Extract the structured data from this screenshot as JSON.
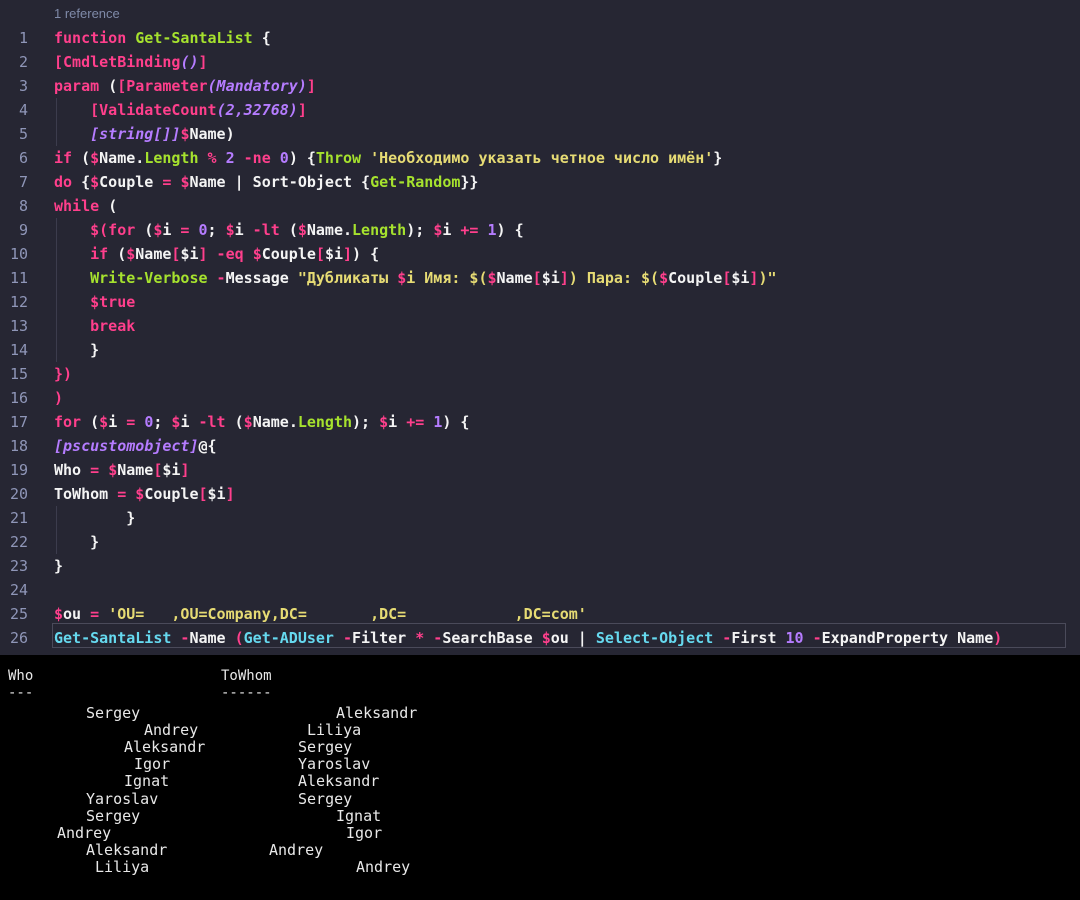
{
  "editor": {
    "codelens": "1 reference",
    "line_numbers": [
      "1",
      "2",
      "3",
      "4",
      "5",
      "6",
      "7",
      "8",
      "9",
      "10",
      "11",
      "12",
      "13",
      "14",
      "15",
      "16",
      "17",
      "18",
      "19",
      "20",
      "21",
      "22",
      "23",
      "24",
      "25",
      "26"
    ],
    "lines": [
      [
        [
          "k",
          "function "
        ],
        [
          "f",
          "Get-SantaList"
        ],
        [
          "p",
          " {"
        ]
      ],
      [
        [
          "k",
          "[CmdletBinding"
        ],
        [
          "t",
          "()"
        ],
        [
          "k",
          "]"
        ]
      ],
      [
        [
          "k",
          "param "
        ],
        [
          "p",
          "("
        ],
        [
          "k",
          "[Parameter"
        ],
        [
          "t",
          "(Mandatory)"
        ],
        [
          "k",
          "]"
        ]
      ],
      [
        [
          "p",
          "    "
        ],
        [
          "k",
          "[ValidateCount"
        ],
        [
          "t",
          "(2,32768)"
        ],
        [
          "k",
          "]"
        ]
      ],
      [
        [
          "p",
          "    "
        ],
        [
          "t",
          "[string[]]"
        ],
        [
          "k",
          "$"
        ],
        [
          "v",
          "Name)"
        ]
      ],
      [
        [
          "k",
          "if "
        ],
        [
          "p",
          "("
        ],
        [
          "k",
          "$"
        ],
        [
          "v",
          "Name"
        ],
        [
          "p",
          "."
        ],
        [
          "prop",
          "Length"
        ],
        [
          "o",
          " % "
        ],
        [
          "n",
          "2"
        ],
        [
          "o",
          " -ne "
        ],
        [
          "n",
          "0"
        ],
        [
          "p",
          ") {"
        ],
        [
          "f",
          "Throw"
        ],
        [
          "s",
          " 'Необходимо указать четное число имён'"
        ],
        [
          "p",
          "}"
        ]
      ],
      [
        [
          "k",
          "do "
        ],
        [
          "p",
          "{"
        ],
        [
          "k",
          "$"
        ],
        [
          "v",
          "Couple"
        ],
        [
          "o",
          " = "
        ],
        [
          "k",
          "$"
        ],
        [
          "v",
          "Name"
        ],
        [
          "p",
          " | Sort-Object {"
        ],
        [
          "f",
          "Get-Random"
        ],
        [
          "p",
          "}}"
        ]
      ],
      [
        [
          "k",
          "while "
        ],
        [
          "p",
          "("
        ]
      ],
      [
        [
          "p",
          "    "
        ],
        [
          "k",
          "$(for "
        ],
        [
          "p",
          "("
        ],
        [
          "k",
          "$"
        ],
        [
          "v",
          "i"
        ],
        [
          "o",
          " = "
        ],
        [
          "n",
          "0"
        ],
        [
          "p",
          "; "
        ],
        [
          "k",
          "$"
        ],
        [
          "v",
          "i"
        ],
        [
          "o",
          " -lt "
        ],
        [
          "p",
          "("
        ],
        [
          "k",
          "$"
        ],
        [
          "v",
          "Name"
        ],
        [
          "p",
          "."
        ],
        [
          "prop",
          "Length"
        ],
        [
          "p",
          "); "
        ],
        [
          "k",
          "$"
        ],
        [
          "v",
          "i"
        ],
        [
          "o",
          " += "
        ],
        [
          "n",
          "1"
        ],
        [
          "p",
          ") {"
        ]
      ],
      [
        [
          "p",
          "    "
        ],
        [
          "k",
          "if "
        ],
        [
          "p",
          "("
        ],
        [
          "k",
          "$"
        ],
        [
          "v",
          "Name"
        ],
        [
          "k",
          "["
        ],
        [
          "v",
          "$i"
        ],
        [
          "k",
          "]"
        ],
        [
          "o",
          " -eq "
        ],
        [
          "k",
          "$"
        ],
        [
          "v",
          "Couple"
        ],
        [
          "k",
          "["
        ],
        [
          "v",
          "$i"
        ],
        [
          "k",
          "]"
        ],
        [
          "p",
          ") {"
        ]
      ],
      [
        [
          "p",
          "    "
        ],
        [
          "f",
          "Write-Verbose"
        ],
        [
          "o",
          " -"
        ],
        [
          "p",
          "Message "
        ],
        [
          "s",
          "\"Дубликаты "
        ],
        [
          "k",
          "$"
        ],
        [
          "s",
          "i Имя: $("
        ],
        [
          "k",
          "$"
        ],
        [
          "v",
          "Name"
        ],
        [
          "k",
          "["
        ],
        [
          "v",
          "$i"
        ],
        [
          "k",
          "]"
        ],
        [
          "s",
          ") Пара: $("
        ],
        [
          "k",
          "$"
        ],
        [
          "v",
          "Couple"
        ],
        [
          "k",
          "["
        ],
        [
          "v",
          "$i"
        ],
        [
          "k",
          "]"
        ],
        [
          "s",
          ")\""
        ]
      ],
      [
        [
          "p",
          "    "
        ],
        [
          "k",
          "$true"
        ]
      ],
      [
        [
          "p",
          "    "
        ],
        [
          "k",
          "break"
        ]
      ],
      [
        [
          "p",
          "    }"
        ]
      ],
      [
        [
          "k",
          "})"
        ]
      ],
      [
        [
          "k",
          ")"
        ]
      ],
      [
        [
          "k",
          "for "
        ],
        [
          "p",
          "("
        ],
        [
          "k",
          "$"
        ],
        [
          "v",
          "i"
        ],
        [
          "o",
          " = "
        ],
        [
          "n",
          "0"
        ],
        [
          "p",
          "; "
        ],
        [
          "k",
          "$"
        ],
        [
          "v",
          "i"
        ],
        [
          "o",
          " -lt "
        ],
        [
          "p",
          "("
        ],
        [
          "k",
          "$"
        ],
        [
          "v",
          "Name"
        ],
        [
          "p",
          "."
        ],
        [
          "prop",
          "Length"
        ],
        [
          "p",
          "); "
        ],
        [
          "k",
          "$"
        ],
        [
          "v",
          "i"
        ],
        [
          "o",
          " += "
        ],
        [
          "n",
          "1"
        ],
        [
          "p",
          ") {"
        ]
      ],
      [
        [
          "t",
          "[pscustomobject]"
        ],
        [
          "p",
          "@{"
        ]
      ],
      [
        [
          "p",
          "Who"
        ],
        [
          "o",
          " = "
        ],
        [
          "k",
          "$"
        ],
        [
          "v",
          "Name"
        ],
        [
          "k",
          "["
        ],
        [
          "v",
          "$i"
        ],
        [
          "k",
          "]"
        ]
      ],
      [
        [
          "p",
          "ToWhom"
        ],
        [
          "o",
          " = "
        ],
        [
          "k",
          "$"
        ],
        [
          "v",
          "Couple"
        ],
        [
          "k",
          "["
        ],
        [
          "v",
          "$i"
        ],
        [
          "k",
          "]"
        ]
      ],
      [
        [
          "p",
          "        }"
        ]
      ],
      [
        [
          "p",
          "    }"
        ]
      ],
      [
        [
          "p",
          "}"
        ]
      ],
      [
        [
          "p",
          ""
        ]
      ],
      [
        [
          "k",
          "$"
        ],
        [
          "v",
          "ou"
        ],
        [
          "o",
          " = "
        ],
        [
          "s",
          "'OU=   ,OU=Company,DC=       ,DC=            ,DC=com'"
        ]
      ],
      [
        [
          "c",
          "Get-SantaList"
        ],
        [
          "o",
          " -"
        ],
        [
          "p",
          "Name "
        ],
        [
          "k",
          "("
        ],
        [
          "c",
          "Get-ADUser"
        ],
        [
          "o",
          " -"
        ],
        [
          "p",
          "Filter "
        ],
        [
          "k",
          "*"
        ],
        [
          "o",
          " -"
        ],
        [
          "p",
          "SearchBase "
        ],
        [
          "k",
          "$"
        ],
        [
          "v",
          "ou"
        ],
        [
          "p",
          " | "
        ],
        [
          "c",
          "Select-Object"
        ],
        [
          "o",
          " -"
        ],
        [
          "p",
          "First "
        ],
        [
          "n",
          "10"
        ],
        [
          "o",
          " -"
        ],
        [
          "p",
          "ExpandProperty Name"
        ],
        [
          "k",
          ")"
        ]
      ]
    ]
  },
  "terminal": {
    "header_who": "Who",
    "header_towhom": "ToWhom",
    "sep_who": "---",
    "sep_towhom": "------",
    "rows": [
      {
        "who": "Sergey",
        "towhom": "Aleksandr"
      },
      {
        "who": "Andrey",
        "towhom": "Liliya"
      },
      {
        "who": "Aleksandr",
        "towhom": "Sergey"
      },
      {
        "who": "Igor",
        "towhom": "Yaroslav"
      },
      {
        "who": "Ignat",
        "towhom": "Aleksandr"
      },
      {
        "who": "Yaroslav",
        "towhom": "Sergey"
      },
      {
        "who": "Sergey",
        "towhom": "Ignat"
      },
      {
        "who": "Andrey",
        "towhom": "Igor"
      },
      {
        "who": "Aleksandr",
        "towhom": "Andrey"
      },
      {
        "who": "Liliya",
        "towhom": "Andrey"
      }
    ]
  },
  "colors": {
    "editor_bg": "#262633",
    "keyword": "#ff3f8c",
    "function": "#a6e22e",
    "string": "#e6db74",
    "type": "#b57cff",
    "cmdlet": "#66d9ef"
  }
}
